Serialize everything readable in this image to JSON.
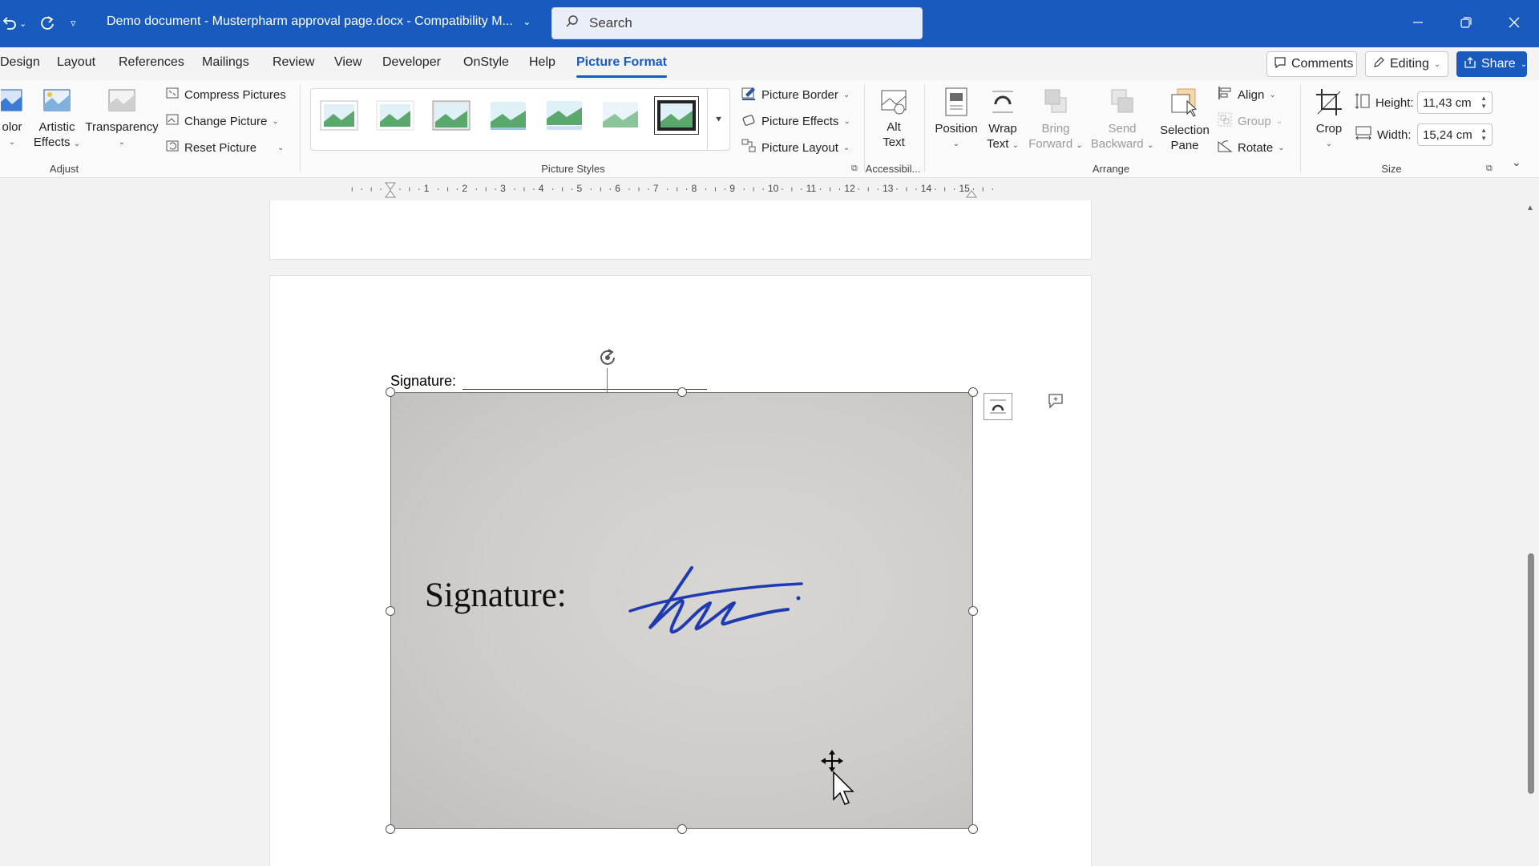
{
  "titlebar": {
    "document_title": "Demo document - Musterpharm approval page.docx - Compatibility M...",
    "search_placeholder": "Search"
  },
  "tabs": [
    "Design",
    "Layout",
    "References",
    "Mailings",
    "Review",
    "View",
    "Developer",
    "OnStyle",
    "Help",
    "Picture Format"
  ],
  "active_tab": "Picture Format",
  "top_buttons": {
    "comments": "Comments",
    "editing": "Editing",
    "share": "Share"
  },
  "ribbon": {
    "adjust": {
      "label": "Adjust",
      "color": "olor",
      "artistic_effects": [
        "Artistic",
        "Effects"
      ],
      "transparency": "Transparency",
      "compress_pictures": "Compress Pictures",
      "change_picture": "Change Picture",
      "reset_picture": "Reset Picture"
    },
    "picture_styles": {
      "label": "Picture Styles",
      "picture_border": "Picture Border",
      "picture_effects": "Picture Effects",
      "picture_layout": "Picture Layout"
    },
    "accessibility": {
      "label": "Accessibil...",
      "alt_text": [
        "Alt",
        "Text"
      ]
    },
    "arrange": {
      "label": "Arrange",
      "position": "Position",
      "wrap_text": [
        "Wrap",
        "Text"
      ],
      "bring_forward": [
        "Bring",
        "Forward"
      ],
      "send_backward": [
        "Send",
        "Backward"
      ],
      "selection_pane": [
        "Selection",
        "Pane"
      ],
      "align": "Align",
      "group": "Group",
      "rotate": "Rotate"
    },
    "size": {
      "label": "Size",
      "crop": "Crop",
      "height_label": "Height:",
      "height_value": "11,43 cm",
      "width_label": "Width:",
      "width_value": "15,24 cm"
    }
  },
  "ruler": {
    "numbers": [
      "1",
      "2",
      "3",
      "4",
      "5",
      "6",
      "7",
      "8",
      "9",
      "10",
      "11",
      "12",
      "13",
      "14",
      "15"
    ]
  },
  "document": {
    "signature_label": "Signature:",
    "image_text": "Signature:"
  },
  "colors": {
    "brand": "#185abd",
    "signature_ink": "#1f3bb3",
    "paper": "#cfcdc9"
  }
}
